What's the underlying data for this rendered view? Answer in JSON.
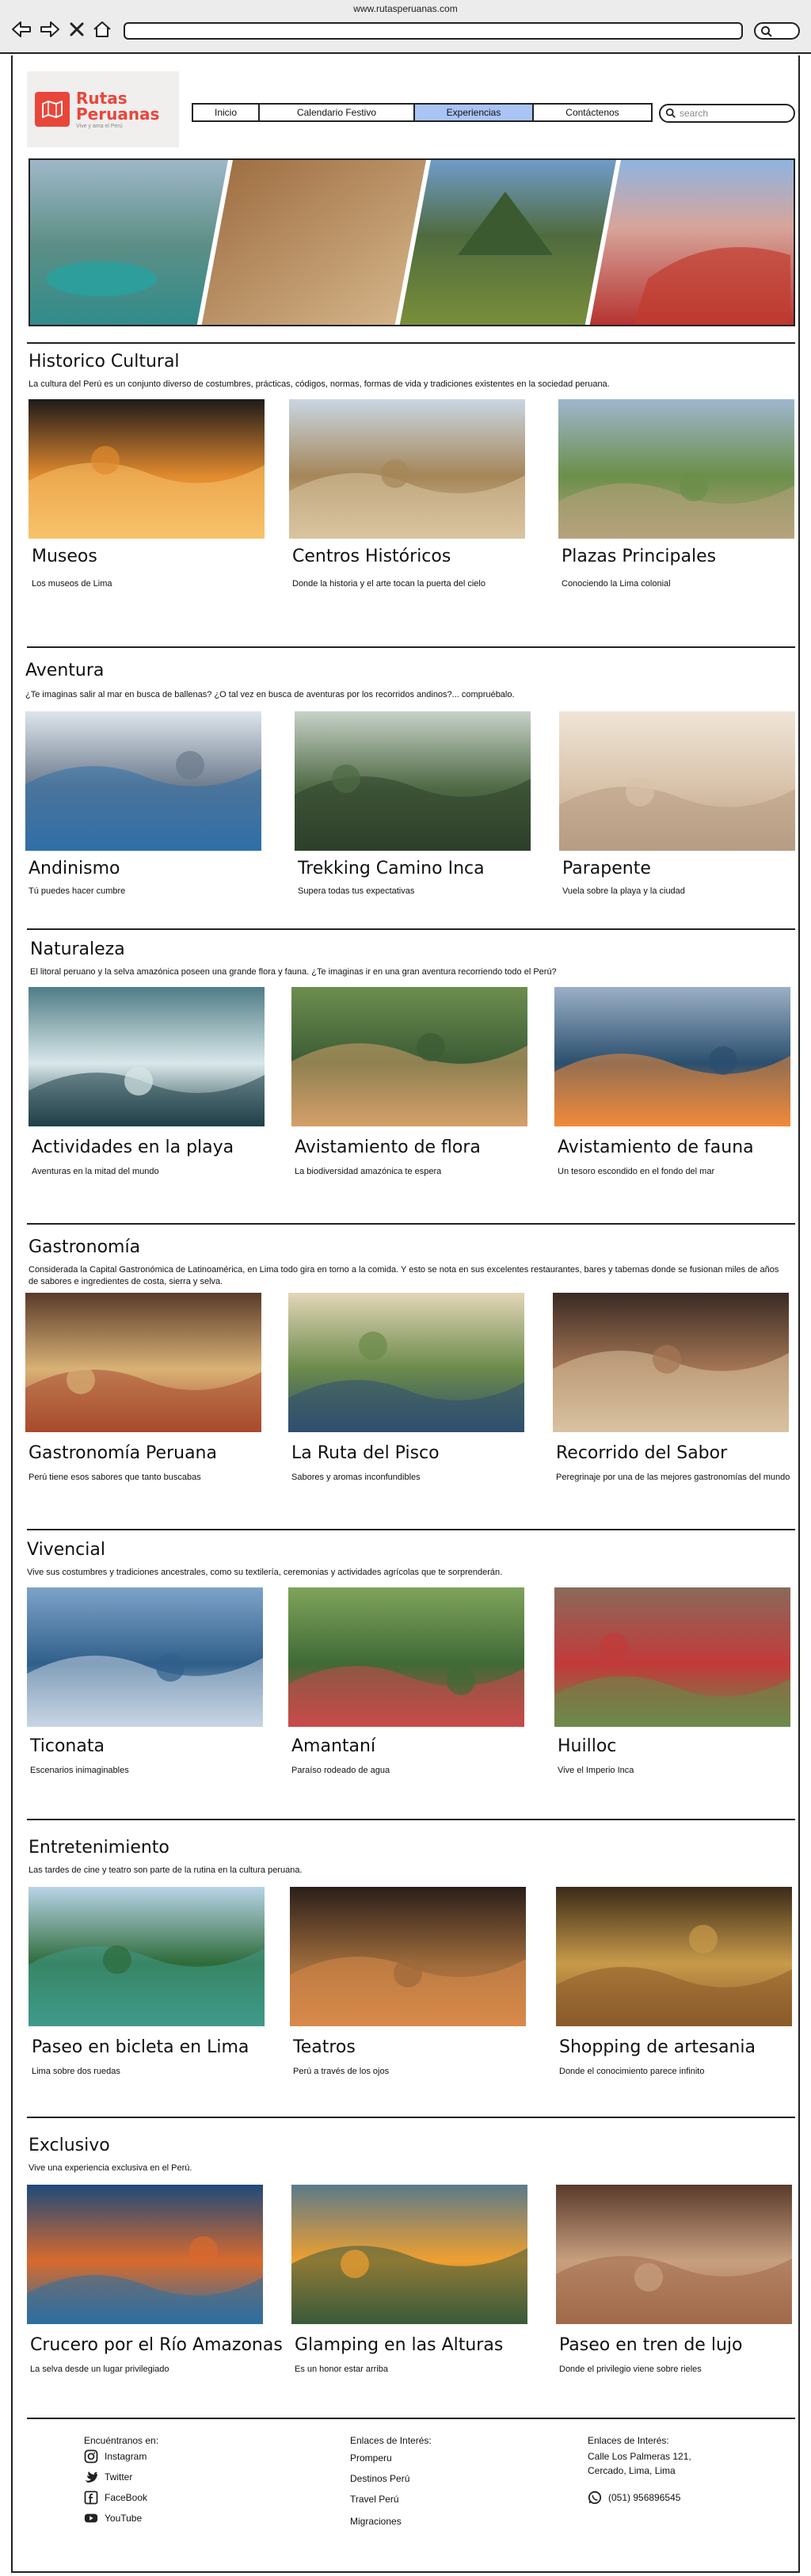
{
  "browser": {
    "url": "www.rutasperuanas.com"
  },
  "logo": {
    "title_line1": "Rutas",
    "title_line2": "Peruanas",
    "tagline": "Vive y ama el Perú"
  },
  "nav": {
    "items": [
      {
        "label": "Inicio"
      },
      {
        "label": "Calendario Festivo"
      },
      {
        "label": "Experiencias"
      },
      {
        "label": "Contáctenos"
      }
    ],
    "search_placeholder": "search"
  },
  "sections": [
    {
      "title": "Historico Cultural",
      "description": "La cultura del Perú es un conjunto diverso de costumbres, prácticas, códigos, normas, formas de vida y tradiciones existentes en la sociedad peruana.",
      "cards": [
        {
          "title": "Museos",
          "subtitle": "Los museos de Lima"
        },
        {
          "title": "Centros Históricos",
          "subtitle": "Donde la historia y el arte tocan la puerta del cielo"
        },
        {
          "title": "Plazas Principales",
          "subtitle": "Conociendo la Lima colonial"
        }
      ]
    },
    {
      "title": "Aventura",
      "description": "¿Te imaginas salir al mar en busca de ballenas? ¿O tal vez en busca de aventuras por los recorridos andinos?... compruébalo.",
      "cards": [
        {
          "title": "Andinismo",
          "subtitle": "Tú puedes hacer cumbre"
        },
        {
          "title": "Trekking Camino Inca",
          "subtitle": "Supera todas tus expectativas"
        },
        {
          "title": "Parapente",
          "subtitle": "Vuela sobre la playa y la ciudad"
        }
      ]
    },
    {
      "title": "Naturaleza",
      "description": "El litoral peruano y la selva amazónica poseen una grande flora y fauna. ¿Te imaginas ir en una gran aventura recorriendo todo el Perú?",
      "cards": [
        {
          "title": "Actividades en la playa",
          "subtitle": "Aventuras en la mitad del mundo"
        },
        {
          "title": "Avistamiento de flora",
          "subtitle": "La biodiversidad amazónica te espera"
        },
        {
          "title": "Avistamiento de fauna",
          "subtitle": "Un tesoro escondido en el fondo del mar"
        }
      ]
    },
    {
      "title": "Gastronomía",
      "description": "Considerada la Capital Gastronómica de Latinoamérica, en Lima todo gira en torno a la comida. Y esto se nota en sus excelentes restaurantes, bares y tabernas donde se fusionan miles de años de sabores e ingredientes de costa, sierra y selva.",
      "cards": [
        {
          "title": "Gastronomía Peruana",
          "subtitle": "Perú tiene esos sabores que tanto buscabas"
        },
        {
          "title": "La Ruta del Pisco",
          "subtitle": "Sabores y aromas inconfundibles"
        },
        {
          "title": "Recorrido del Sabor",
          "subtitle": "Peregrinaje por una de las mejores gastronomías del mundo"
        }
      ]
    },
    {
      "title": "Vivencial",
      "description": "Vive sus costumbres y tradiciones ancestrales, como su textilería, ceremonias y actividades agrícolas que te sorprenderán.",
      "cards": [
        {
          "title": "Ticonata",
          "subtitle": "Escenarios inimaginables"
        },
        {
          "title": "Amantaní",
          "subtitle": "Paraíso rodeado de agua"
        },
        {
          "title": "Huilloc",
          "subtitle": "Vive el Imperio Inca"
        }
      ]
    },
    {
      "title": "Entretenimiento",
      "description": "Las tardes de cine y teatro son parte de la rutina en la cultura peruana.",
      "cards": [
        {
          "title": "Paseo en bicleta en Lima",
          "subtitle": "Lima sobre dos ruedas"
        },
        {
          "title": "Teatros",
          "subtitle": "Perú a través de los ojos"
        },
        {
          "title": "Shopping de artesania",
          "subtitle": "Donde el conocimiento parece infinito"
        }
      ]
    },
    {
      "title": "Exclusivo",
      "description": "Vive una experiencia exclusiva en el Perú.",
      "cards": [
        {
          "title": "Crucero por el Río Amazonas",
          "subtitle": "La selva desde un lugar privilegiado"
        },
        {
          "title": "Glamping en las Alturas",
          "subtitle": "Es un honor estar arriba"
        },
        {
          "title": "Paseo en tren de lujo",
          "subtitle": "Donde el privilegio viene sobre rieles"
        }
      ]
    }
  ],
  "footer": {
    "col1_title": "Encuéntranos en:",
    "social": [
      {
        "label": "Instagram",
        "icon": "instagram-icon"
      },
      {
        "label": "Twitter",
        "icon": "twitter-icon"
      },
      {
        "label": "FaceBook",
        "icon": "facebook-icon"
      },
      {
        "label": "YouTube",
        "icon": "youtube-icon"
      }
    ],
    "col2_title": "Enlaces de Interés:",
    "links": [
      {
        "label": "Promperu"
      },
      {
        "label": "Destinos Perú"
      },
      {
        "label": "Travel Perú"
      },
      {
        "label": "Migraciones"
      }
    ],
    "col3_title": "Enlaces de Interés:",
    "address_line1": "Calle Los Palmeras 121,",
    "address_line2": "Cercado, Lima, Lima",
    "phone": "(051) 956896545"
  }
}
